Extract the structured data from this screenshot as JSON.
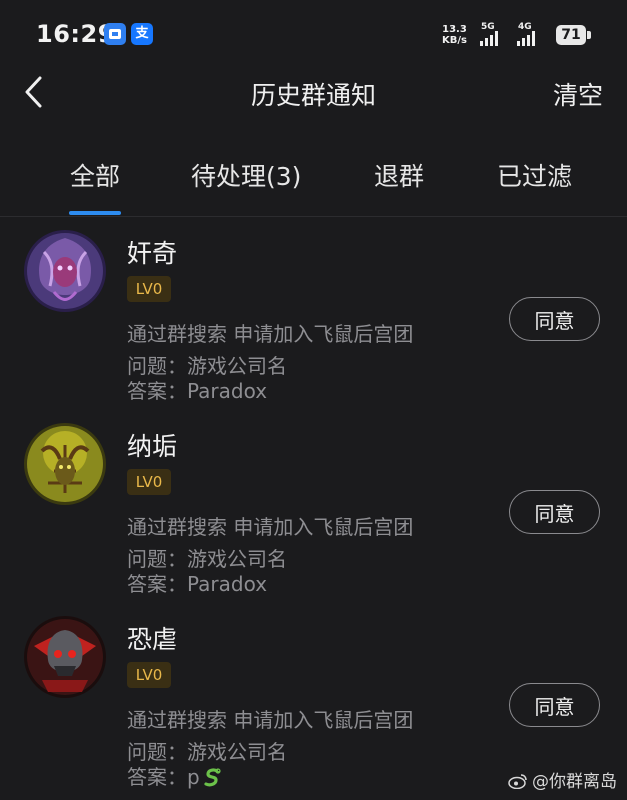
{
  "status_bar": {
    "time": "16:29",
    "app_badge_1": "",
    "app_badge_2": "支",
    "speed_value": "13.3",
    "speed_unit": "KB/s",
    "net1": "5G",
    "net2": "4G",
    "battery": "71"
  },
  "header": {
    "title": "历史群通知",
    "clear_label": "清空"
  },
  "tabs": [
    {
      "label": "全部",
      "active": true
    },
    {
      "label": "待处理(3)",
      "active": false
    },
    {
      "label": "退群",
      "active": false
    },
    {
      "label": "已过滤",
      "active": false
    }
  ],
  "requests": [
    {
      "nickname": "奸奇",
      "level": "LV0",
      "via": "通过群搜索 申请加入飞鼠后宫团",
      "question": "问题：游戏公司名",
      "answer": "答案：Paradox",
      "button": "同意",
      "avatar_icon": "purple-demon-avatar"
    },
    {
      "nickname": "纳垢",
      "level": "LV0",
      "via": "通过群搜索 申请加入飞鼠后宫团",
      "question": "问题：游戏公司名",
      "answer": "答案：Paradox",
      "button": "同意",
      "avatar_icon": "green-plague-avatar"
    },
    {
      "nickname": "恐虐",
      "level": "LV0",
      "via": "通过群搜索 申请加入飞鼠后宫团",
      "question": "问题：游戏公司名",
      "answer": "答案：p",
      "button": "同意",
      "avatar_icon": "red-skull-avatar"
    }
  ],
  "watermark": "@你群离岛",
  "colors": {
    "background": "#1b1b1d",
    "accent": "#2d8cf0",
    "level_text": "#e9b84a",
    "level_bg": "#3a2f14",
    "secondary_text": "#8e8e92"
  }
}
